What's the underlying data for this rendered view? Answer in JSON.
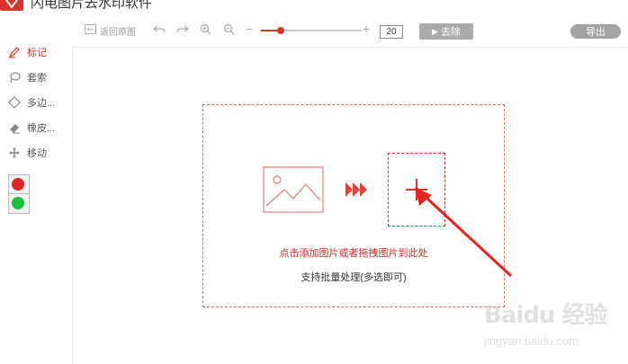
{
  "app": {
    "title": "闪电图片去水印软件"
  },
  "sidebar": {
    "tools": [
      {
        "label": "标记",
        "icon": "pen-icon"
      },
      {
        "label": "套索",
        "icon": "lasso-icon"
      },
      {
        "label": "多边...",
        "icon": "polygon-icon"
      },
      {
        "label": "橡皮...",
        "icon": "eraser-icon"
      },
      {
        "label": "移动",
        "icon": "move-icon"
      }
    ],
    "colors": {
      "red": "#e02424",
      "green": "#18c23a"
    }
  },
  "toolbar": {
    "restore_label": "返回原图",
    "zoom_value": "20",
    "slider_fraction": 0.2,
    "remove_label": "去除",
    "export_label": "导出"
  },
  "dropzone": {
    "hint": "点击添加图片或者拖拽图片到此处",
    "batch": "支持批量处理(多选即可)"
  },
  "watermark": {
    "brand": "Baidu 经验",
    "url": "jingyan.baidu.com"
  },
  "colors": {
    "accent": "#d9352b",
    "button_gray": "#aaaaaa"
  }
}
